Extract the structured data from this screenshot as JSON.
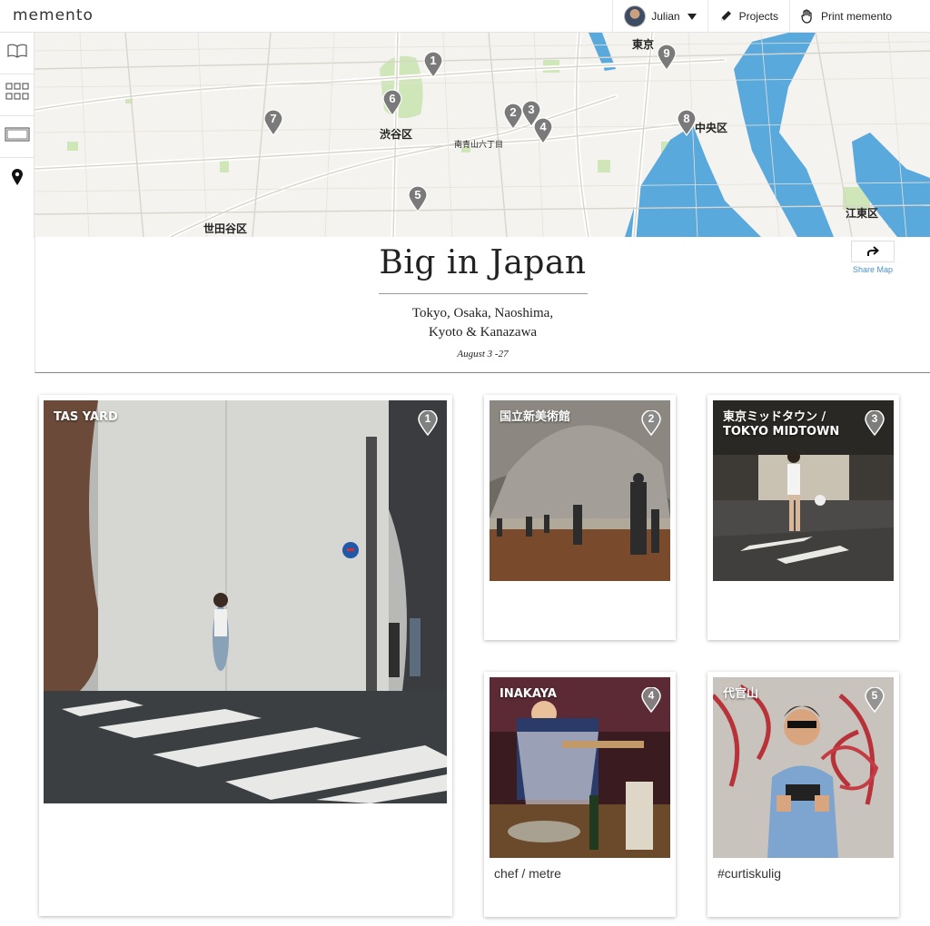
{
  "app": {
    "logo": "memento"
  },
  "nav": {
    "user_name": "Julian",
    "projects_label": "Projects",
    "print_label": "Print memento"
  },
  "sidebar": {
    "items": [
      {
        "icon": "book-icon"
      },
      {
        "icon": "grid-icon"
      },
      {
        "icon": "single-view-icon"
      },
      {
        "icon": "map-pin-icon"
      }
    ]
  },
  "map": {
    "labels": [
      "東京",
      "渋谷区",
      "中央区",
      "世田谷区",
      "江東区",
      "南青山六丁目"
    ],
    "pins": [
      "1",
      "2",
      "3",
      "4",
      "5",
      "6",
      "7",
      "8",
      "9"
    ]
  },
  "header": {
    "title": "Big in Japan",
    "subtitle_line1": "Tokyo, Osaka, Naoshima,",
    "subtitle_line2": "Kyoto & Kanazawa",
    "dates": "August 3 -27",
    "share_label": "Share Map"
  },
  "cards": [
    {
      "title": "TAS YARD",
      "number": "1",
      "caption": ""
    },
    {
      "title": "国立新美術館",
      "number": "2",
      "caption": ""
    },
    {
      "title": "東京ミッドタウン /\nTOKYO MIDTOWN",
      "number": "3",
      "caption": ""
    },
    {
      "title": "INAKAYA",
      "number": "4",
      "caption": "chef / metre"
    },
    {
      "title": "代官山",
      "number": "5",
      "caption": "#curtiskulig"
    }
  ],
  "colors": {
    "map_water": "#5aa9dc",
    "map_park": "#cfe6b8",
    "pin_gray": "#7a7a7a",
    "link_blue": "#4a90c8"
  }
}
